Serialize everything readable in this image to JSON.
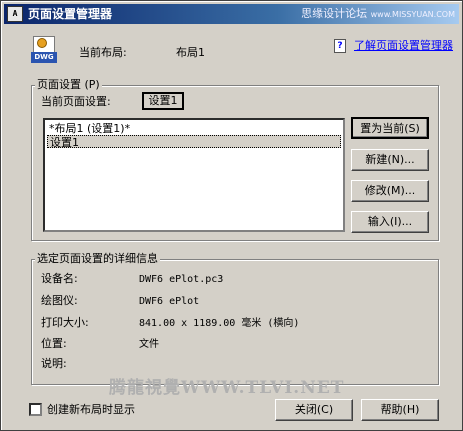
{
  "window": {
    "title": "页面设置管理器",
    "icon_text": "A",
    "watermark_top": "思缘设计论坛",
    "watermark_top_small": "www.MISSYUAN.COM"
  },
  "header": {
    "icon_label": "DWG",
    "current_layout_label": "当前布局:",
    "current_layout_value": "布局1",
    "help_link": "了解页面设置管理器"
  },
  "page_setup": {
    "group_title": "页面设置 (P)",
    "current_label": "当前页面设置:",
    "current_value": "设置1",
    "list_items": [
      "*布局1 (设置1)*",
      "设置1"
    ],
    "buttons": {
      "set_current": "置为当前(S)",
      "new": "新建(N)...",
      "modify": "修改(M)...",
      "import": "输入(I)..."
    }
  },
  "details": {
    "group_title": "选定页面设置的详细信息",
    "rows": [
      {
        "label": "设备名:",
        "value": "DWF6 ePlot.pc3"
      },
      {
        "label": "绘图仪:",
        "value": "DWF6 ePlot"
      },
      {
        "label": "打印大小:",
        "value": "841.00 x 1189.00 毫米 (横向)"
      },
      {
        "label": "位置:",
        "value": "文件"
      },
      {
        "label": "说明:",
        "value": ""
      }
    ]
  },
  "watermark_center": "腾龍視覺WWW.TLVI.NET",
  "footer": {
    "checkbox_label": "创建新布局时显示",
    "checkbox_checked": false,
    "close_button": "关闭(C)",
    "help_button": "帮助(H)"
  }
}
